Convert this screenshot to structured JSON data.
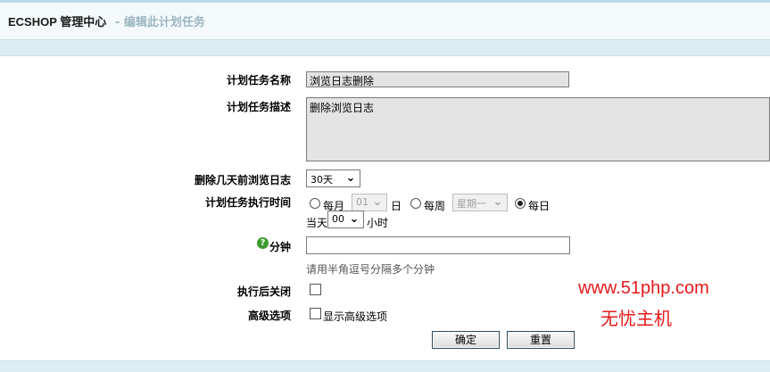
{
  "header": {
    "brand": "ECSHOP 管理中心",
    "subtitle": "- 编辑此计划任务"
  },
  "form": {
    "name_label": "计划任务名称",
    "name_value": "浏览日志删除",
    "desc_label": "计划任务描述",
    "desc_value": "删除浏览日志",
    "days_label": "删除几天前浏览日志",
    "days_value": "30天",
    "time_label": "计划任务执行时间",
    "monthly_label": "每月",
    "monthly_day": "01",
    "day_suffix": "日",
    "weekly_label": "每周",
    "weekday": "星期一",
    "daily_label": "每日",
    "daily_selected": true,
    "day_prefix": "当天",
    "hour_value": "00",
    "hour_suffix": "小时",
    "minute_label": "分钟",
    "minute_value": "",
    "minute_hint": "请用半角逗号分隔多个分钟",
    "close_after_label": "执行后关闭",
    "close_after_checked": false,
    "advanced_label": "高级选项",
    "show_advanced_label": "显示高级选项",
    "show_advanced_checked": false
  },
  "buttons": {
    "submit": "确定",
    "reset": "重置"
  },
  "watermark": {
    "url": "www.51php.com",
    "text": "无忧主机"
  },
  "colors": {
    "header_bg": "#f4fafb",
    "page_bg": "#ddeef2",
    "subtitle": "#9cb6c1",
    "watermark": "#e5191a",
    "help_icon": "#3c9a2e"
  },
  "icons": {
    "help": "help-icon",
    "dropdown": "chevron-down-icon"
  }
}
